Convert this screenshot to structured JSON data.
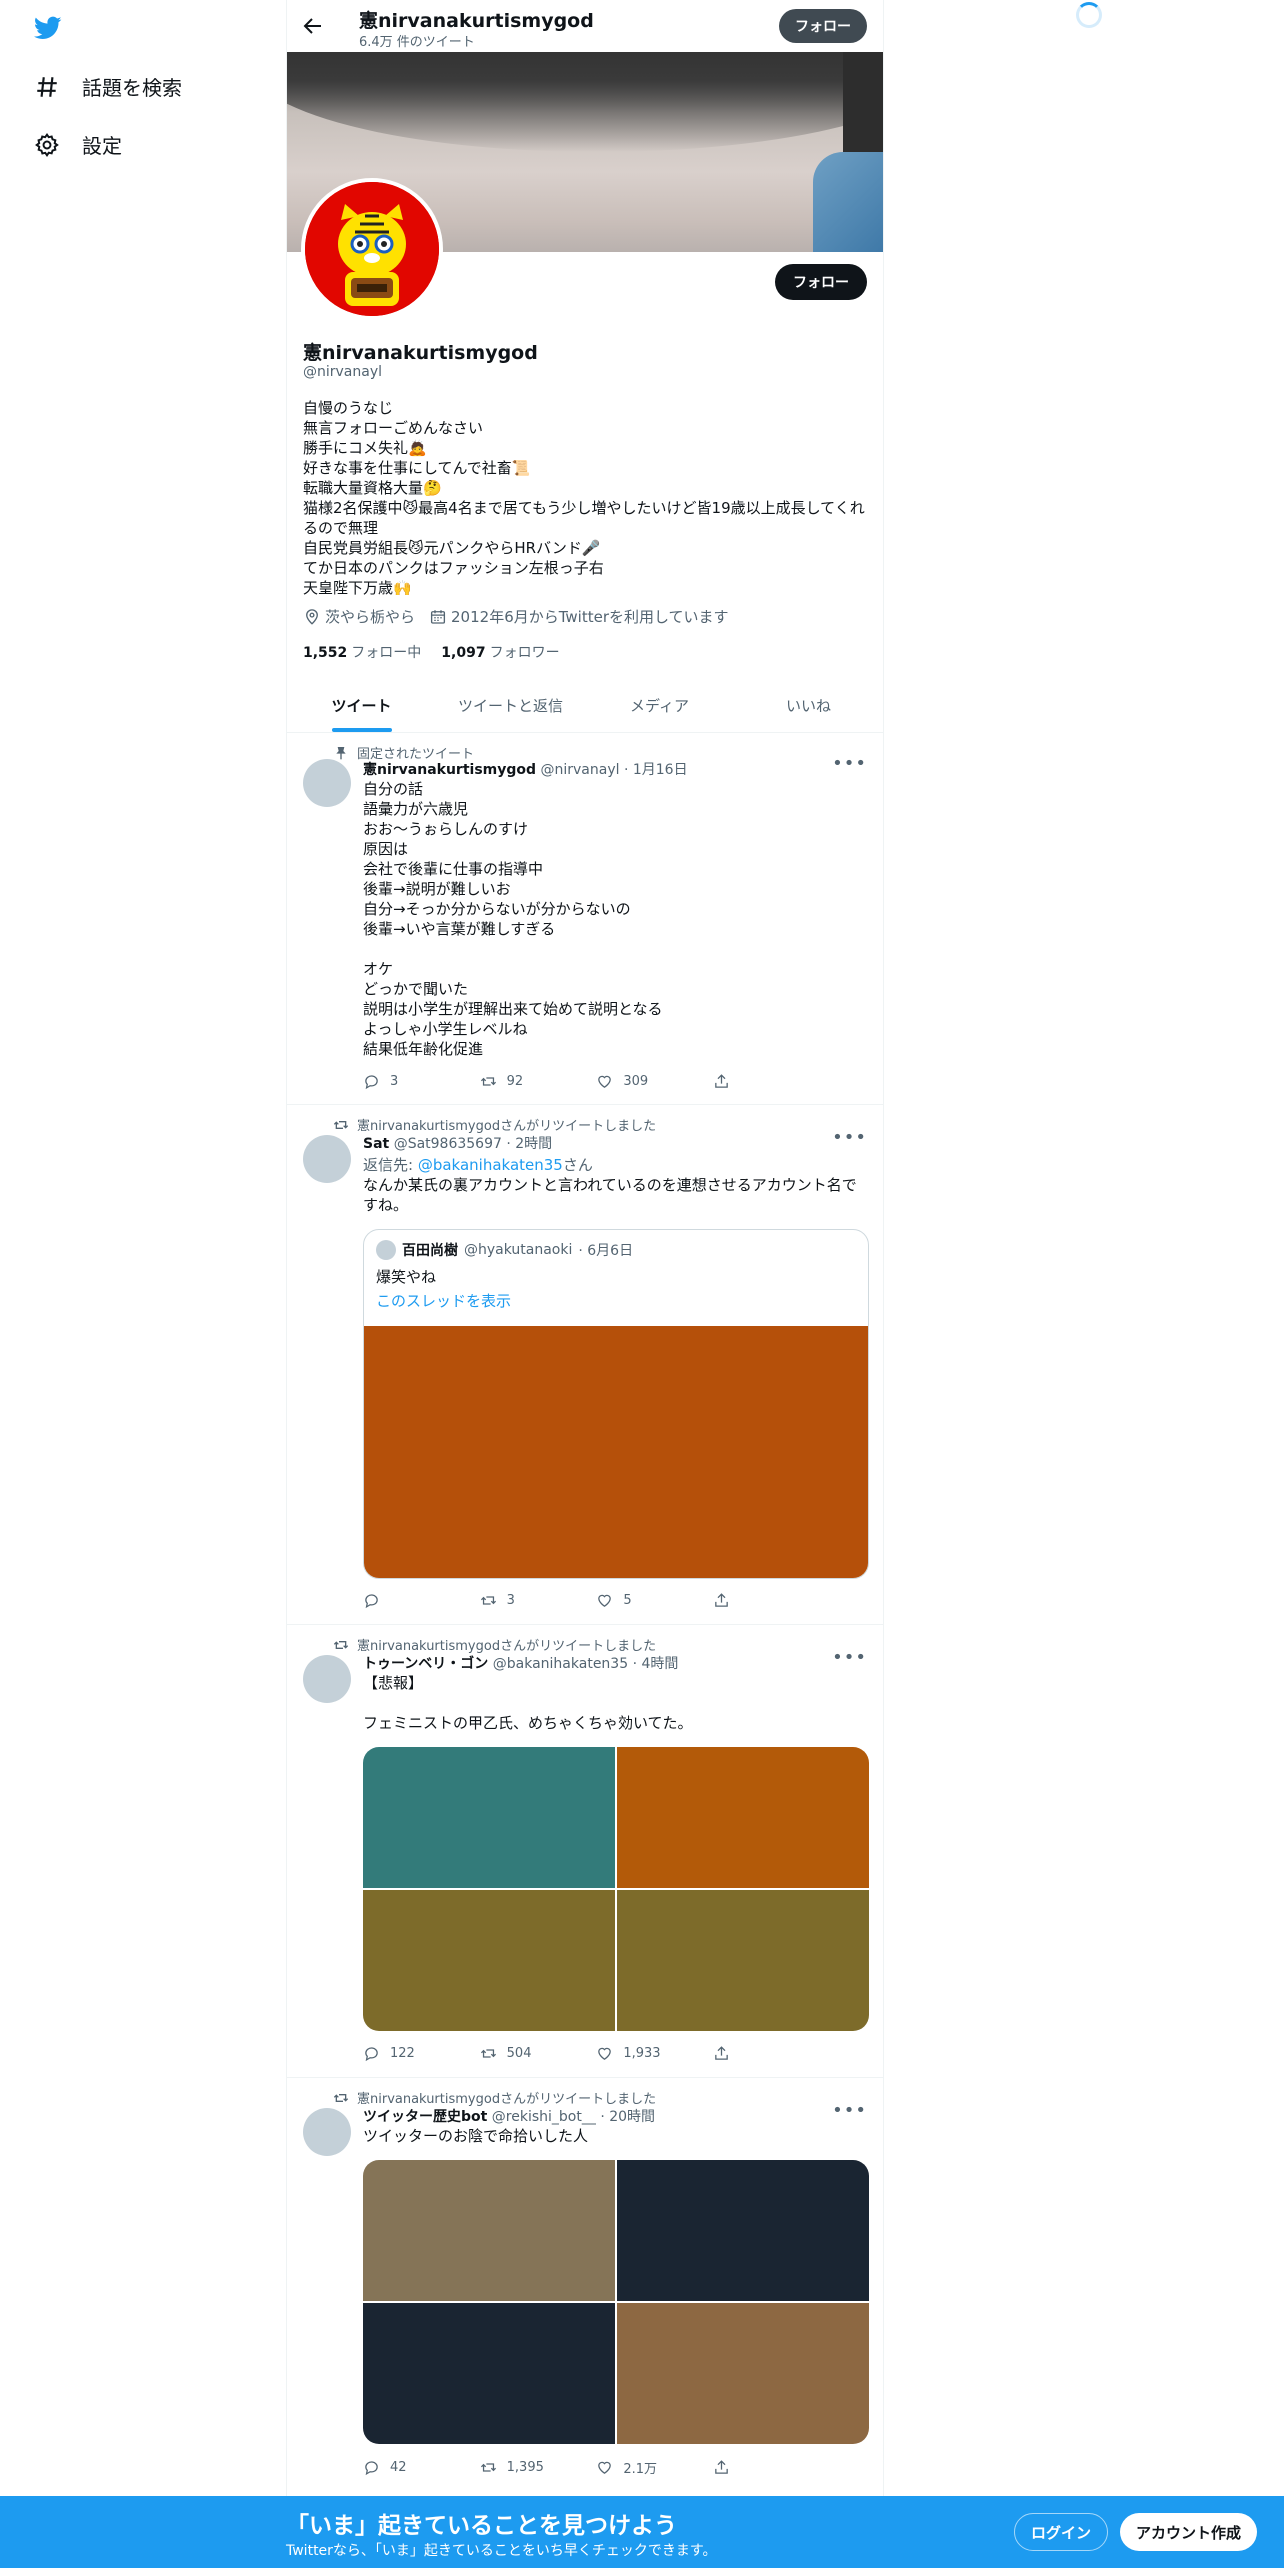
{
  "sidebar": {
    "items": [
      {
        "label": "話題を検索",
        "icon": "hashtag-icon"
      },
      {
        "label": "設定",
        "icon": "gear-icon"
      }
    ]
  },
  "topbar": {
    "name": "憲nirvanakurtismygod",
    "tweet_count": "6.4万 件のツイート",
    "follow_label": "フォロー"
  },
  "profile": {
    "name": "憲nirvanakurtismygod",
    "handle": "@nirvanayl",
    "follow_label": "フォロー",
    "bio": [
      "自慢のうなじ",
      "無言フォローごめんなさい",
      "勝手にコメ失礼🙇",
      "好きな事を仕事にしてんで社畜📜",
      "転職大量資格大量🤔",
      "猫様2名保護中😼最高4名まで居てもう少し増やしたいけど皆19歳以上成長してくれるので無理",
      "自民党員労組長😼元パンクやらHRバンド🎤",
      "てか日本のパンクはファッション左根っ子右",
      "天皇陛下万歳🙌"
    ],
    "location": "茨やら栃やら",
    "joined": "2012年6月からTwitterを利用しています",
    "following_count": "1,552",
    "following_label": "フォロー中",
    "followers_count": "1,097",
    "followers_label": "フォロワー"
  },
  "tabs": [
    {
      "label": "ツイート",
      "active": true
    },
    {
      "label": "ツイートと返信",
      "active": false
    },
    {
      "label": "メディア",
      "active": false
    },
    {
      "label": "いいね",
      "active": false
    }
  ],
  "tweets": [
    {
      "context": "固定されたツイート",
      "name": "憲nirvanakurtismygod",
      "handle": "@nirvanayl",
      "time": "· 1月16日",
      "lines": [
        "自分の話",
        "語彙力が六歳児",
        "おお～うぉらしんのすけ",
        "原因は",
        "会社で後輩に仕事の指導中",
        "後輩→説明が難しいお",
        "自分→そっか分からないが分からないの",
        "後輩→いや言葉が難しすぎる",
        "",
        "オケ",
        "どっかで聞いた",
        "説明は小学生が理解出来て始めて説明となる",
        "よっしゃ小学生レベルね",
        "結果低年齢化促進"
      ],
      "replies": "3",
      "retweets": "92",
      "likes": "309"
    },
    {
      "context": "憲nirvanakurtismygodさんがリツイートしました",
      "name": "Sat",
      "handle": "@Sat98635697",
      "time": "· 2時間",
      "reply_prefix": "返信先: ",
      "reply_to": "@bakanihakaten35",
      "reply_suffix": "さん",
      "lines": [
        "なんか某氏の裏アカウントと言われているのを連想させるアカウント名ですね。"
      ],
      "quote": {
        "name": "百田尚樹",
        "handle": "@hyakutanaoki",
        "time": "· 6月6日",
        "text": "爆笑やね",
        "thread_link": "このスレッドを表示",
        "image_color": "#b5500a"
      },
      "replies": "",
      "retweets": "3",
      "likes": "5"
    },
    {
      "context": "憲nirvanakurtismygodさんがリツイートしました",
      "name": "トゥーンベリ・ゴン",
      "handle": "@bakanihakaten35",
      "time": "· 4時間",
      "lines": [
        "【悲報】",
        "",
        "フェミニストの甲乙氏、めちゃくちゃ効いてた。"
      ],
      "images": [
        "#337b7a",
        "#b35a09",
        "#7d6b2a",
        "#7d6b2a"
      ],
      "replies": "122",
      "retweets": "504",
      "likes": "1,933"
    },
    {
      "context": "憲nirvanakurtismygodさんがリツイートしました",
      "name": "ツイッター歴史bot",
      "handle": "@rekishi_bot__",
      "time": "· 20時間",
      "lines": [
        "ツイッターのお陰で命拾いした人"
      ],
      "images": [
        "#857457",
        "#1a2532",
        "#1a2532",
        "#8d6842"
      ],
      "replies": "42",
      "retweets": "1,395",
      "likes": "2.1万"
    }
  ],
  "bottom_banner": {
    "title": "「いま」起きていることを見つけよう",
    "subtitle": "Twitterなら、「いま」起きていることをいち早くチェックできます。",
    "login_label": "ログイン",
    "signup_label": "アカウント作成"
  },
  "colors": {
    "accent": "#1d9bf0",
    "text": "#0f1419",
    "secondary": "#536471"
  }
}
